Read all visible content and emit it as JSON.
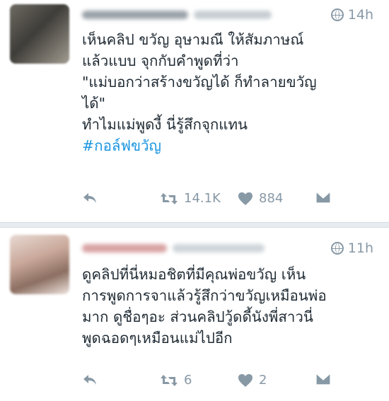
{
  "tweets": [
    {
      "time": "14h",
      "lines": [
        "เห็นคลิป ขวัญ อุษามณี ให้สัมภาษณ์",
        "แล้วแบบ จุกกับคำพูดที่ว่า",
        "\"แม่บอกว่าสร้างขวัญได้ ก็ทำลายขวัญ",
        "ได้\"",
        "ทำไมแม่พูดงี้ นี่รู้สึกจุกแทน"
      ],
      "hashtag": "#กอล์ฟขวัญ",
      "retweets": "14.1K",
      "likes": "884"
    },
    {
      "time": "11h",
      "lines": [
        "ดูคลิปที่นี่หมอชิตที่มีคุณพ่อขวัญ เห็น",
        "การพูดการจาแล้วรู้สึกว่าขวัญเหมือนพ่อ",
        "มาก ดูชื่อๆอะ ส่วนคลิปวู้ดดี้นังพี่สาวนี่",
        "พูดฉอดๆเหมือนแม่ไปอีก"
      ],
      "retweets": "6",
      "likes": "2"
    }
  ],
  "icons": {
    "time": "globe-icon",
    "reply": "reply-icon",
    "retweet": "retweet-icon",
    "like": "heart-icon",
    "message": "direct-message-icon"
  },
  "colors": {
    "text": "#1f2a33",
    "muted": "#8899a6",
    "hashtag": "#1b95e0",
    "separator": "#e6ecf0"
  }
}
